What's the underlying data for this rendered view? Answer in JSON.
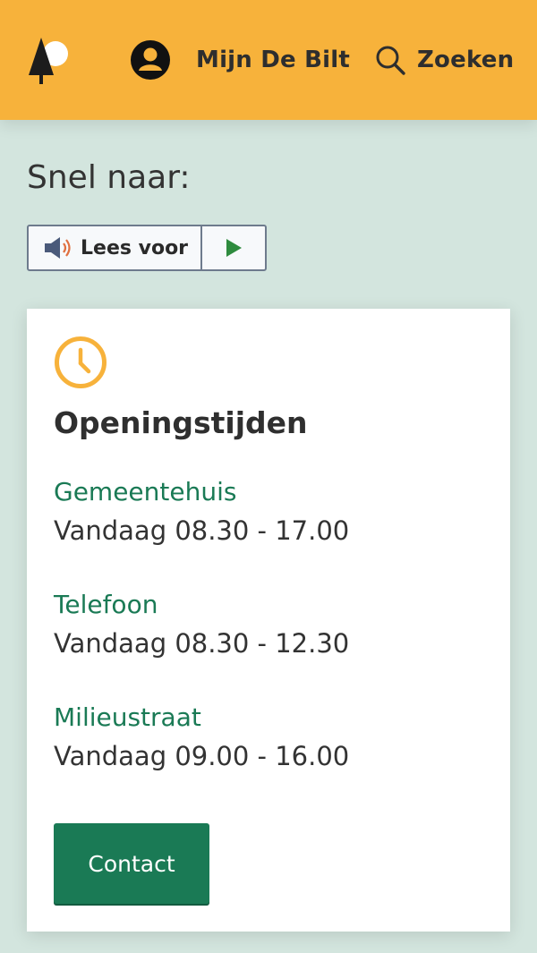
{
  "header": {
    "logo_icon": "tree-sun-logo-icon",
    "account_label": "Mijn De Bilt",
    "account_icon": "user-circle-icon",
    "search_label": "Zoeken",
    "search_icon": "search-icon",
    "background": "#f7b23b"
  },
  "page": {
    "heading": "Snel naar:",
    "background": "#d3e5de"
  },
  "readspeaker": {
    "label": "Lees voor",
    "speaker_icon": "speaker-icon",
    "play_icon": "play-icon"
  },
  "card": {
    "icon": "clock-icon",
    "title": "Openingstijden",
    "items": [
      {
        "name": "Gemeentehuis",
        "hours": "Vandaag 08.30 - 17.00"
      },
      {
        "name": "Telefoon",
        "hours": "Vandaag 08.30 - 12.30"
      },
      {
        "name": "Milieustraat",
        "hours": "Vandaag 09.00 - 16.00"
      }
    ],
    "contact_label": "Contact",
    "accent_color": "#1a7a55",
    "icon_color": "#f7b23b"
  }
}
